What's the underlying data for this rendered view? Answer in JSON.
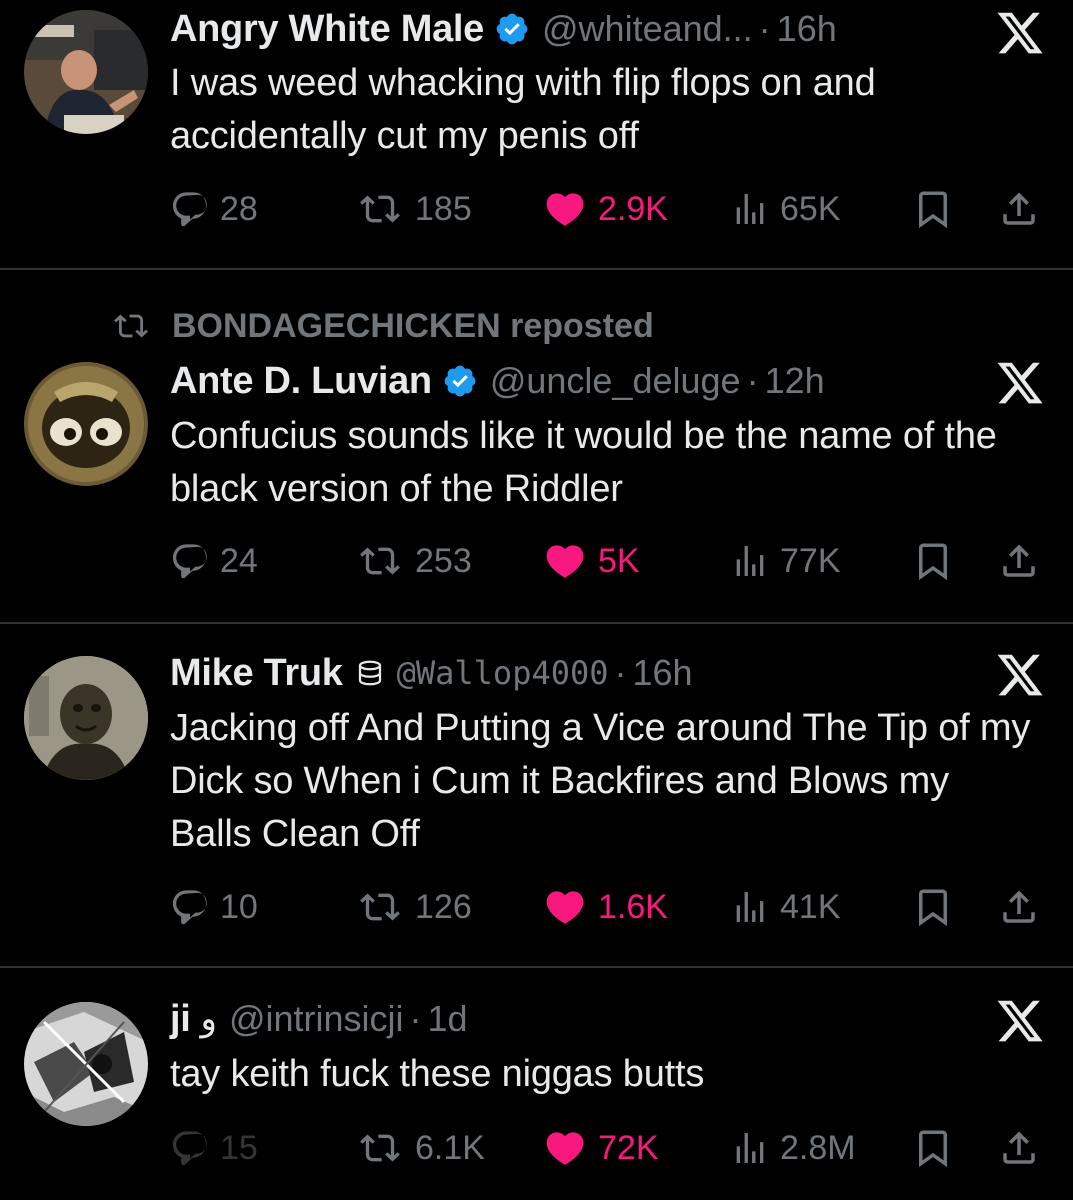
{
  "tweets": [
    {
      "name": "Angry White Male",
      "verified": true,
      "handle": "@whiteand...",
      "time": "16h",
      "text": "I was weed whacking with flip flops on and accidentally cut my penis off",
      "replies": "28",
      "reposts": "185",
      "likes": "2.9K",
      "views": "65K"
    },
    {
      "reposted_by": "BONDAGECHICKEN reposted",
      "name": "Ante D. Luvian",
      "verified": true,
      "handle": "@uncle_deluge",
      "time": "12h",
      "text": "Confucius sounds like it would be the name of the black version of the Riddler",
      "replies": "24",
      "reposts": "253",
      "likes": "5K",
      "views": "77K"
    },
    {
      "name": "Mike Truk",
      "badge_icon": "database-icon",
      "handle": "@Wallop4000",
      "time": "16h",
      "text": "Jacking off And Putting a Vice around The Tip of my Dick so When i Cum it  Backfires and Blows my Balls Clean Off",
      "replies": "10",
      "reposts": "126",
      "likes": "1.6K",
      "views": "41K"
    },
    {
      "name": "ji",
      "badge_icon": "arabic-glyph-icon",
      "badge_glyph": "و",
      "handle": "@intrinsicji",
      "time": "1d",
      "text": "tay keith fuck these niggas butts",
      "replies": "15",
      "reposts": "6.1K",
      "likes": "72K",
      "views": "2.8M"
    }
  ],
  "separator": "·",
  "colors": {
    "background": "#000000",
    "text": "#e7e9ea",
    "secondary": "#71767b",
    "like": "#f91880",
    "verified": "#1d9bf0",
    "divider": "#2f3336"
  }
}
